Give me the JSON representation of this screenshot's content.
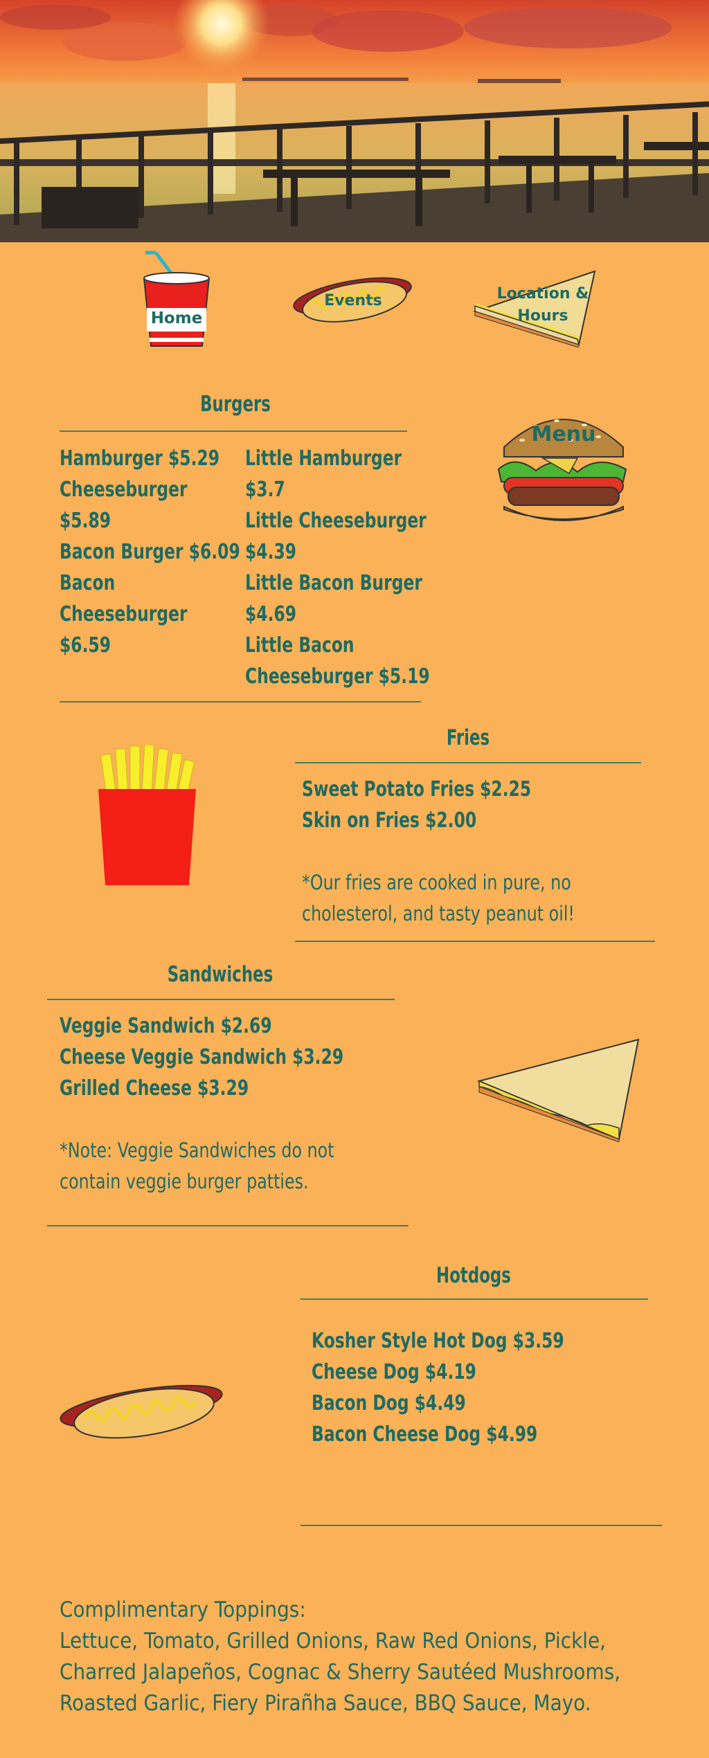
{
  "nav": {
    "home_label": "Home",
    "events_label": "Events",
    "location_label_line1": "Location &",
    "location_label_line2": "Hours",
    "menu_label": "Menu"
  },
  "burgers": {
    "title": "Burgers",
    "col1": [
      "Hamburger $5.29",
      "Cheeseburger",
      "$5.89",
      "Bacon Burger $6.09",
      "Bacon",
      "Cheeseburger",
      "$6.59"
    ],
    "col2": [
      "Little Hamburger",
      "$3.7",
      "Little Cheeseburger",
      "$4.39",
      "Little Bacon Burger",
      "$4.69",
      "Little Bacon",
      "Cheeseburger $5.19"
    ]
  },
  "fries": {
    "title": "Fries",
    "items": [
      "Sweet Potato Fries $2.25",
      "Skin on Fries $2.00"
    ],
    "note_line1": "*Our fries are cooked in pure, no",
    "note_line2": "cholesterol, and tasty peanut oil!"
  },
  "sandwiches": {
    "title": "Sandwiches",
    "items": [
      "Veggie Sandwich $2.69",
      "Cheese Veggie Sandwich $3.29",
      "Grilled Cheese $3.29"
    ],
    "note_line1": "*Note: Veggie Sandwiches do not",
    "note_line2": "contain veggie burger patties."
  },
  "hotdogs": {
    "title": "Hotdogs",
    "items": [
      "Kosher Style Hot Dog $3.59",
      "Cheese Dog $4.19",
      "Bacon Dog $4.49",
      "Bacon Cheese Dog $4.99"
    ]
  },
  "toppings": {
    "heading": "Complimentary Toppings:",
    "line1": "Lettuce, Tomato, Grilled Onions, Raw Red Onions, Pickle,",
    "line2": "Charred Jalapeños, Cognac & Sherry Sautéed Mushrooms,",
    "line3": "Roasted Garlic, Fiery Pirañha Sauce, BBQ Sauce, Mayo."
  },
  "colors": {
    "background": "#fbb157",
    "text": "#1e6b63",
    "rule": "#3e7f6a"
  }
}
